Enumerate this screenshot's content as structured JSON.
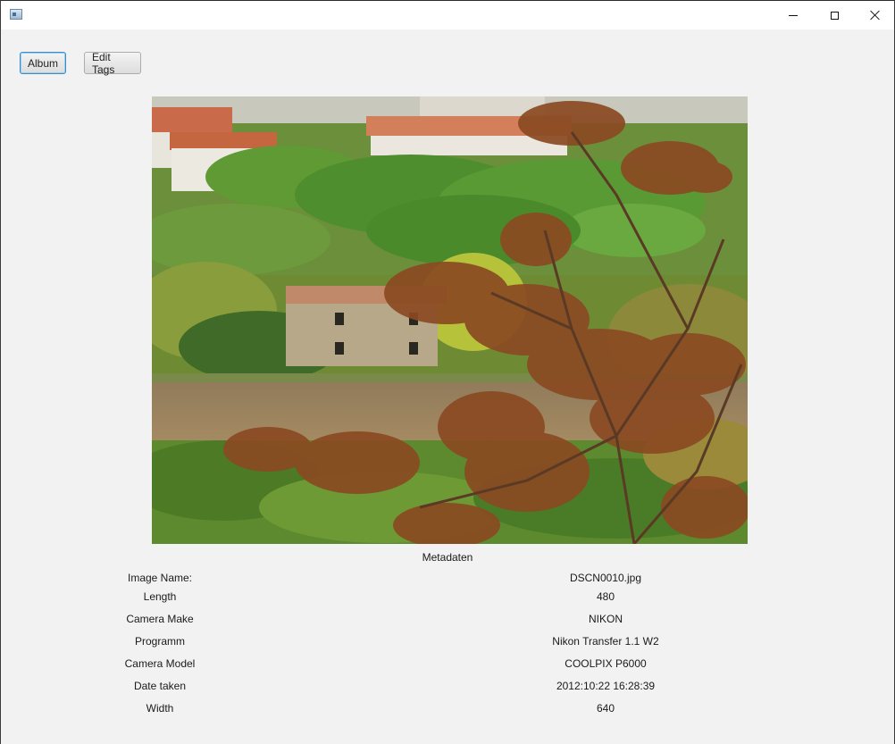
{
  "window": {
    "icon": "java-app-icon"
  },
  "toolbar": {
    "album_label": "Album",
    "edit_tags_label": "Edit Tags"
  },
  "photo": {
    "description_icon": "landscape-photo"
  },
  "metadata": {
    "title": "Metadaten",
    "rows": [
      {
        "key": "Image Name:",
        "value": "DSCN0010.jpg"
      },
      {
        "key": "Length",
        "value": "480"
      },
      {
        "key": "Camera Make",
        "value": "NIKON"
      },
      {
        "key": "Programm",
        "value": "Nikon Transfer 1.1 W2"
      },
      {
        "key": "Camera Model",
        "value": "COOLPIX P6000"
      },
      {
        "key": "Date taken",
        "value": "2012:10:22 16:28:39"
      },
      {
        "key": "Width",
        "value": "640"
      }
    ]
  },
  "colors": {
    "window_bg": "#f2f2f2",
    "focus_border": "#3c8ecb"
  }
}
